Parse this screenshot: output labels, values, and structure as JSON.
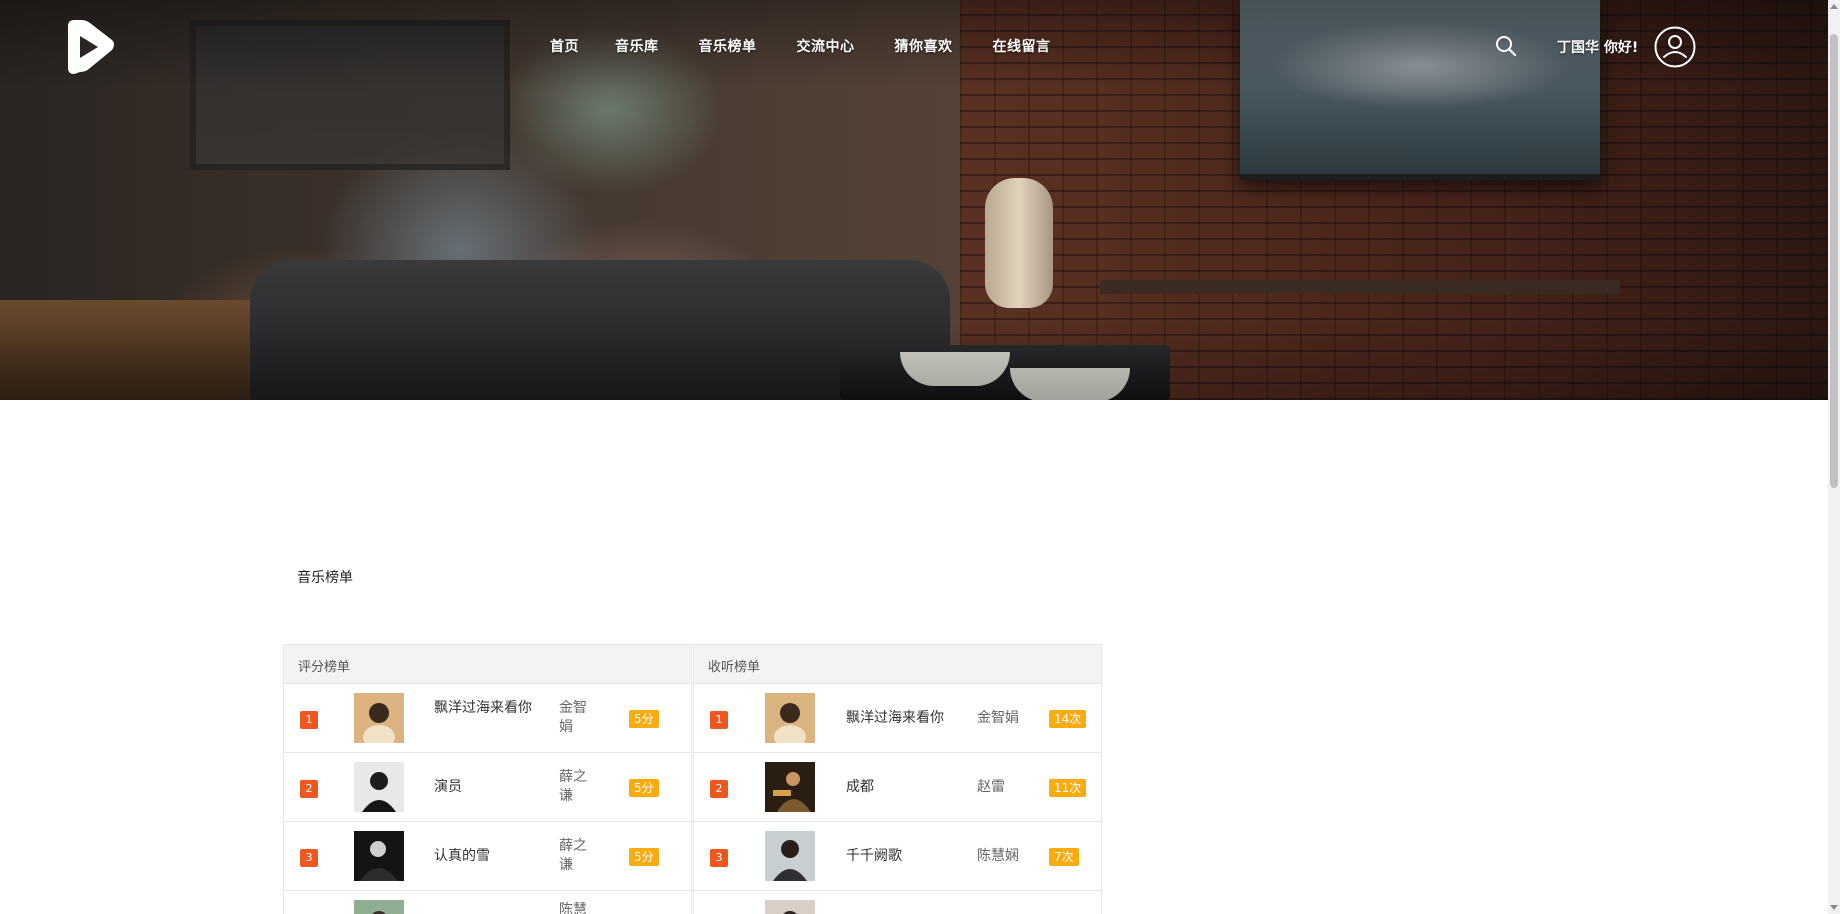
{
  "nav": {
    "items": [
      {
        "label": "首页"
      },
      {
        "label": "音乐库"
      },
      {
        "label": "音乐榜单"
      },
      {
        "label": "交流中心"
      },
      {
        "label": "猜你喜欢"
      },
      {
        "label": "在线留言"
      }
    ],
    "greeting": "丁国华 你好!"
  },
  "section_title": "音乐榜单",
  "rating_board": {
    "title": "评分榜单",
    "rows": [
      {
        "rank": "1",
        "song": "飘洋过海来看你",
        "singer": "金智娟",
        "score": "5分"
      },
      {
        "rank": "2",
        "song": "演员",
        "singer": "薛之谦",
        "score": "5分"
      },
      {
        "rank": "3",
        "song": "认真的雪",
        "singer": "薛之谦",
        "score": "5分"
      },
      {
        "rank": "",
        "song": "",
        "singer": "陈慧",
        "score": ""
      }
    ]
  },
  "listen_board": {
    "title": "收听榜单",
    "rows": [
      {
        "rank": "1",
        "song": "飘洋过海来看你",
        "singer": "金智娟",
        "plays": "14次"
      },
      {
        "rank": "2",
        "song": "成都",
        "singer": "赵雷",
        "plays": "11次"
      },
      {
        "rank": "3",
        "song": "千千阙歌",
        "singer": "陈慧娴",
        "plays": "7次"
      }
    ]
  },
  "icons": {
    "logo": "play-logo-icon",
    "search": "search-icon",
    "user": "user-avatar-icon"
  },
  "colors": {
    "rank_badge": "#f0571f",
    "score_badge": "#f9ab10",
    "board_header_bg": "#f3f3f3"
  }
}
